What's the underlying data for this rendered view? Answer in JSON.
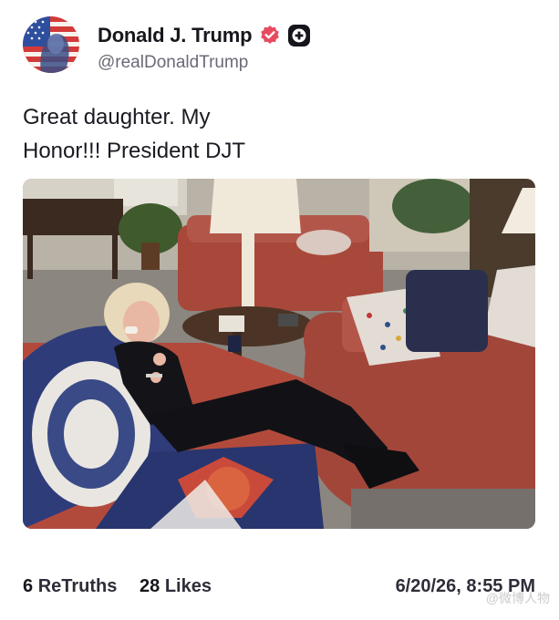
{
  "author": {
    "display_name": "Donald J. Trump",
    "handle": "@realDonaldTrump",
    "avatar_icon": "american-flag-portrait-avatar",
    "verified_icon": "verified-badge-icon",
    "verified_color": "#e64a5f",
    "plus_badge_icon": "plus-badge-icon"
  },
  "post": {
    "text_line1": "Great daughter. My",
    "text_line2": "Honor!!! President DJT",
    "photo_alt": "woman on phone seated on red sofa in living room"
  },
  "stats": {
    "retruths_count": "6",
    "retruths_label": "ReTruths",
    "likes_count": "28",
    "likes_label": "Likes",
    "timestamp": "6/20/26, 8:55 PM"
  },
  "watermark": "@微博人物"
}
